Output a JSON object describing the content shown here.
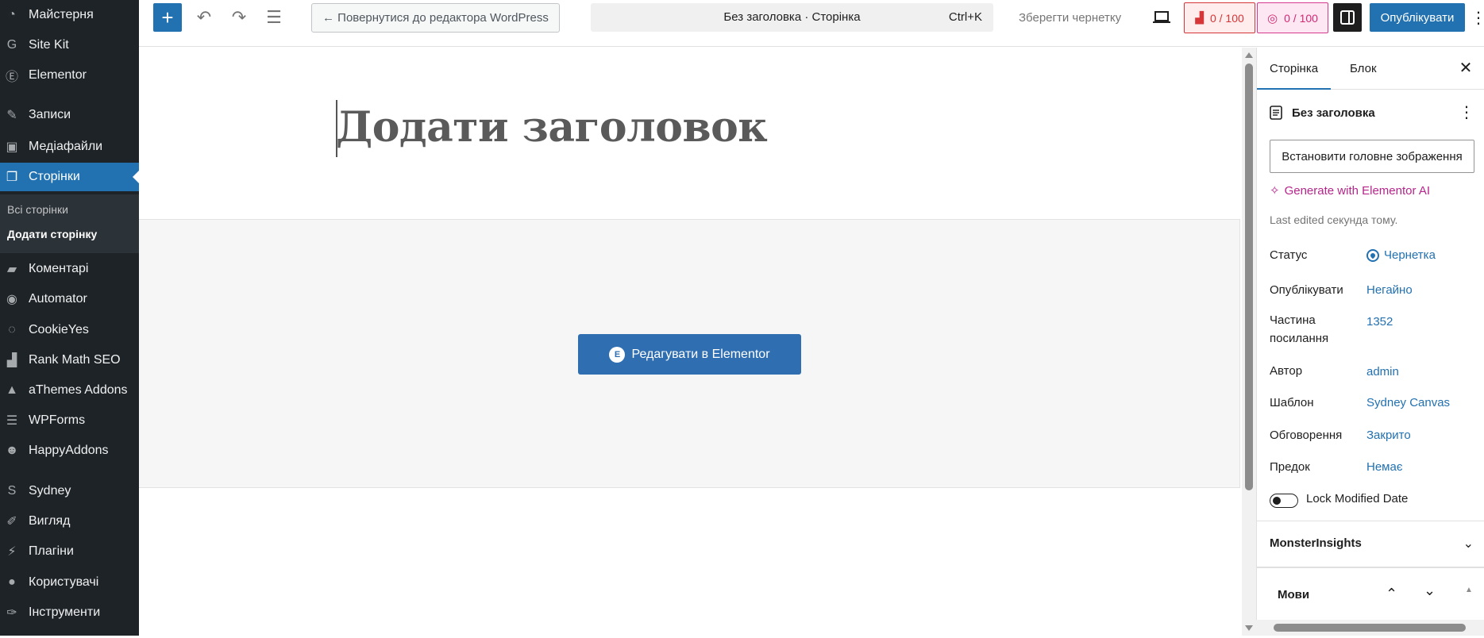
{
  "admin_menu": [
    {
      "label": "Майстерня",
      "icon": "dashboard-icon",
      "glyph": "◔"
    },
    {
      "label": "Site Kit",
      "icon": "sitekit-icon",
      "glyph": "G"
    },
    {
      "label": "Elementor",
      "icon": "elementor-icon",
      "glyph": "Ⓔ"
    },
    {
      "label": "Записи",
      "icon": "pushpin-icon",
      "glyph": "✎"
    },
    {
      "label": "Медіафайли",
      "icon": "media-icon",
      "glyph": "▣"
    },
    {
      "label": "Сторінки",
      "icon": "pages-icon",
      "glyph": "❐",
      "active": true
    },
    {
      "label": "Коментарі",
      "icon": "comments-icon",
      "glyph": "▰"
    },
    {
      "label": "Automator",
      "icon": "automator-icon",
      "glyph": "◉"
    },
    {
      "label": "CookieYes",
      "icon": "cookie-icon",
      "glyph": "◌"
    },
    {
      "label": "Rank Math SEO",
      "icon": "rankmath-icon",
      "glyph": "▟"
    },
    {
      "label": "aThemes Addons",
      "icon": "athemes-icon",
      "glyph": "▲"
    },
    {
      "label": "WPForms",
      "icon": "wpforms-icon",
      "glyph": "☰"
    },
    {
      "label": "HappyAddons",
      "icon": "happyaddons-icon",
      "glyph": "☻"
    },
    {
      "label": "Sydney",
      "icon": "sydney-icon",
      "glyph": "S"
    },
    {
      "label": "Вигляд",
      "icon": "appearance-icon",
      "glyph": "✐"
    },
    {
      "label": "Плагіни",
      "icon": "plugins-icon",
      "glyph": "⚡"
    },
    {
      "label": "Користувачі",
      "icon": "users-icon",
      "glyph": "●"
    },
    {
      "label": "Інструменти",
      "icon": "tools-icon",
      "glyph": "✑"
    }
  ],
  "submenu": {
    "all_pages": "Всі сторінки",
    "add_page": "Додати сторінку"
  },
  "toolbar": {
    "add_glyph": "+",
    "undo_glyph": "↶",
    "redo_glyph": "↷",
    "outline_glyph": "☰",
    "back_label": "← Повернутися до редактора WordPress",
    "doc_title": "Без заголовка · Сторінка",
    "shortcut": "Ctrl+K",
    "save_draft": "Зберегти чернетку",
    "seo_score": "0 / 100",
    "ai_score": "0 / 100",
    "publish": "Опублікувати"
  },
  "canvas": {
    "title_placeholder": "Додати заголовок",
    "edit_elementor": "Редагувати в Elementor"
  },
  "panel": {
    "tab_page": "Сторінка",
    "tab_block": "Блок",
    "doc_name": "Без заголовка",
    "featured_image": "Встановити головне зображення",
    "generate_ai": "Generate with Elementor AI",
    "last_edited": "Last edited секунда тому.",
    "rows": {
      "status_label": "Статус",
      "status_value": "Чернетка",
      "publish_label": "Опублікувати",
      "publish_value": "Негайно",
      "permalink_label_1": "Частина",
      "permalink_label_2": "посилання",
      "permalink_value": "1352",
      "author_label": "Автор",
      "author_value": "admin",
      "template_label": "Шаблон",
      "template_value": "Sydney Canvas",
      "comments_label": "Обговорення",
      "comments_value": "Закрито",
      "parent_label": "Предок",
      "parent_value": "Немає"
    },
    "lock_modified": "Lock Modified Date",
    "monsterinsights": "MonsterInsights",
    "languages": "Мови"
  },
  "colors": {
    "accent": "#2271b1",
    "sidebar_bg": "#1d2327",
    "score_red": "#d63638",
    "ai_pink": "#d12a75"
  }
}
